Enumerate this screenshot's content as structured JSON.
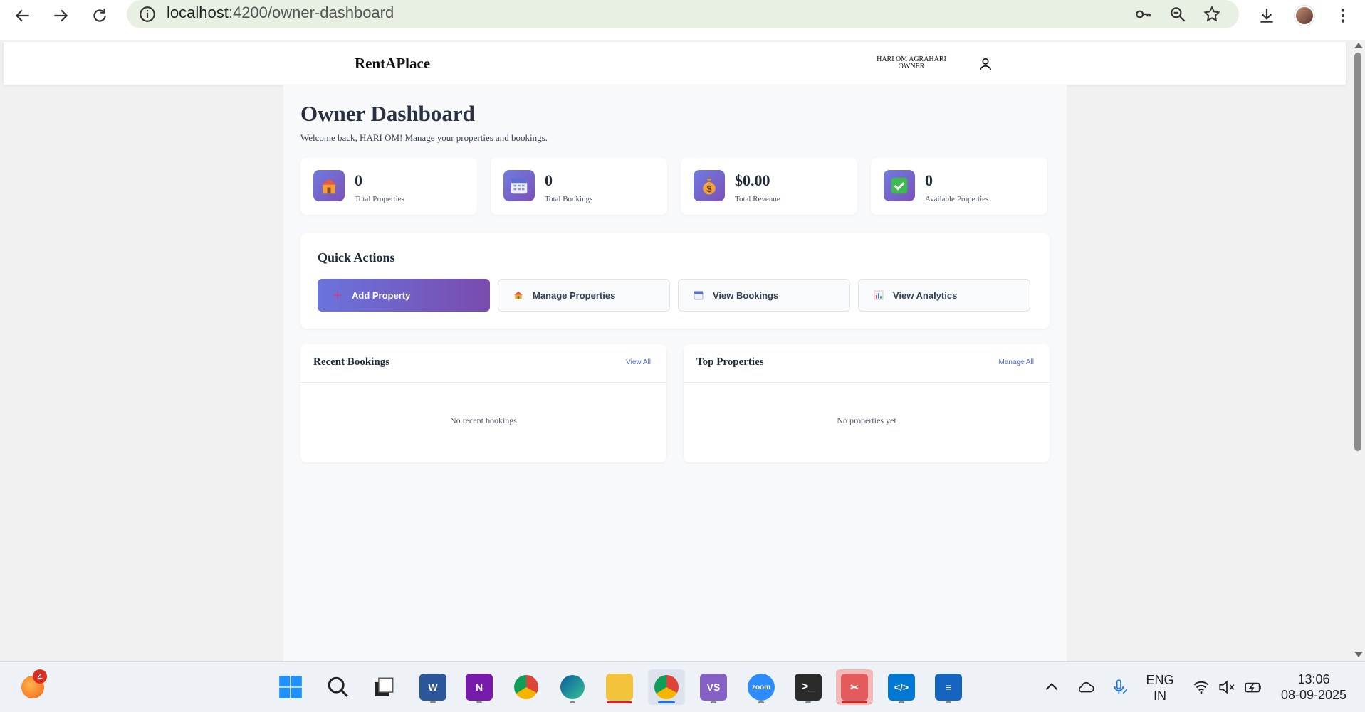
{
  "browser": {
    "url_host": "localhost",
    "url_path": ":4200/owner-dashboard"
  },
  "header": {
    "brand": "RentAPlace",
    "user_name": "HARI OM AGRAHARI",
    "user_role": "OWNER"
  },
  "dashboard": {
    "title": "Owner Dashboard",
    "subtitle": "Welcome back, HARI OM! Manage your properties and bookings.",
    "stats": [
      {
        "value": "0",
        "label": "Total Properties",
        "icon": "house-icon"
      },
      {
        "value": "0",
        "label": "Total Bookings",
        "icon": "calendar-icon"
      },
      {
        "value": "$0.00",
        "label": "Total Revenue",
        "icon": "money-bag-icon"
      },
      {
        "value": "0",
        "label": "Available Properties",
        "icon": "check-icon"
      }
    ],
    "quick_actions": {
      "title": "Quick Actions",
      "buttons": [
        {
          "label": "Add Property",
          "icon": "plus-icon"
        },
        {
          "label": "Manage Properties",
          "icon": "house-icon"
        },
        {
          "label": "View Bookings",
          "icon": "calendar-icon"
        },
        {
          "label": "View Analytics",
          "icon": "bar-chart-icon"
        }
      ]
    },
    "recent_bookings": {
      "title": "Recent Bookings",
      "link": "View All",
      "empty": "No recent bookings"
    },
    "top_properties": {
      "title": "Top Properties",
      "link": "Manage All",
      "empty": "No properties yet"
    }
  },
  "taskbar": {
    "notification_count": "4",
    "lang_top": "ENG",
    "lang_bottom": "IN",
    "time": "13:06",
    "date": "08-09-2025"
  },
  "colors": {
    "accent_start": "#6a74dc",
    "accent_end": "#7a4bae",
    "link": "#4f6bd8"
  }
}
